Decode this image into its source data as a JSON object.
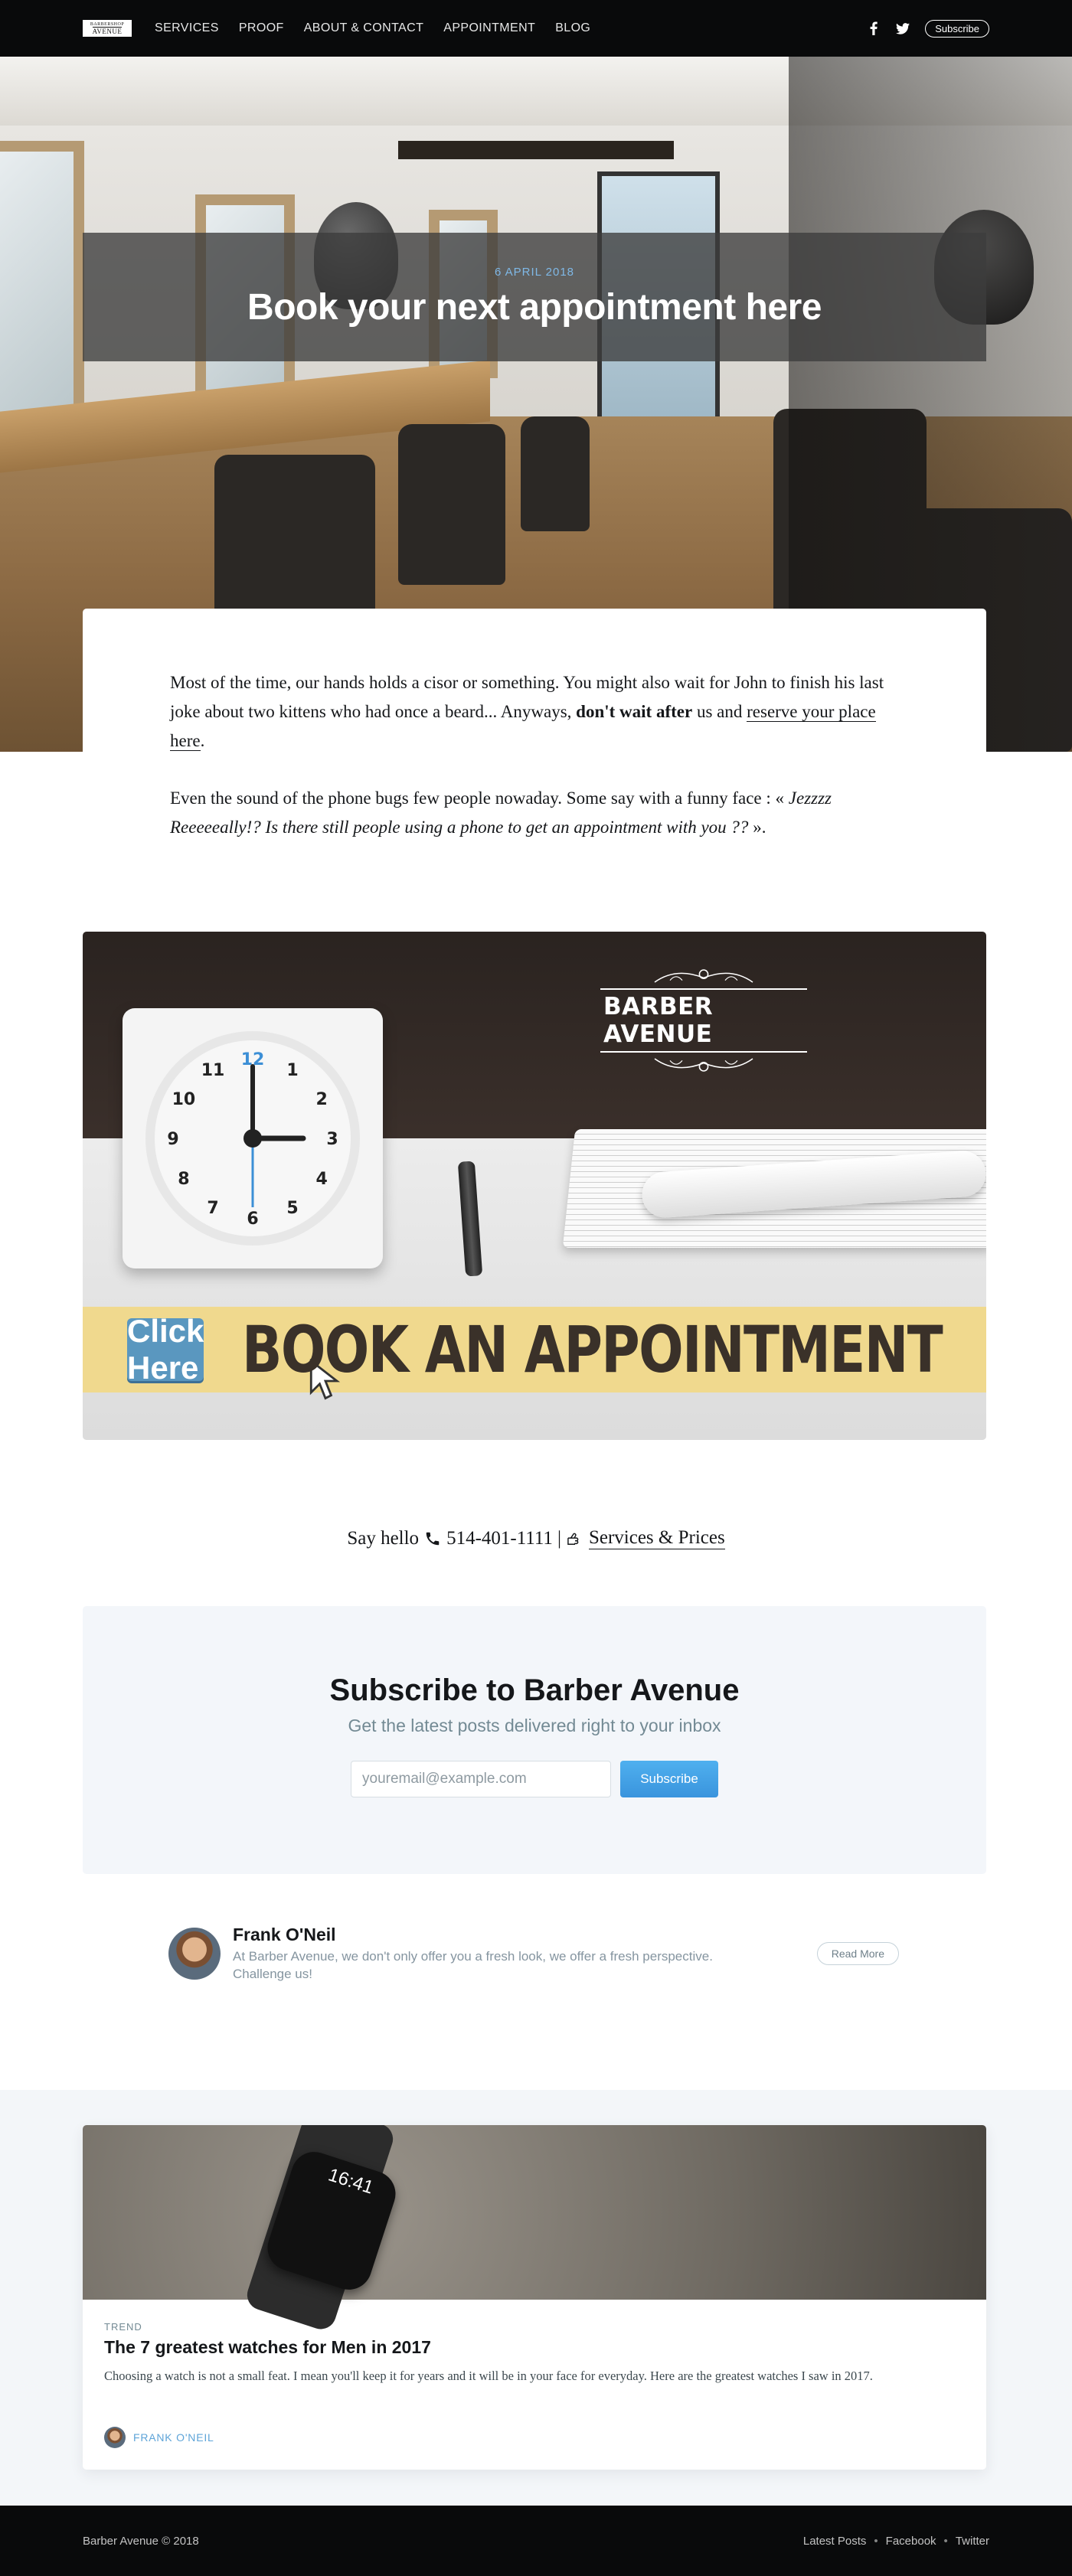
{
  "nav": {
    "logo_line1": "BARBERSHOP",
    "logo_line2": "AVENUE",
    "links": [
      "SERVICES",
      "PROOF",
      "ABOUT & CONTACT",
      "APPOINTMENT",
      "BLOG"
    ],
    "social_icons": [
      "facebook-icon",
      "twitter-icon"
    ],
    "subscribe_label": "Subscribe"
  },
  "hero": {
    "date": "6 APRIL 2018",
    "title": "Book your next appointment here"
  },
  "post": {
    "p1_start": "Most of the time, our hands holds a cisor or something. You might also wait for John to finish his last joke about two kittens who had once a beard... Anyways, ",
    "p1_bold": "don't wait after",
    "p1_mid": " us and ",
    "p1_link": "reserve your place here",
    "p1_end": ".",
    "p2_start": "Even the sound of the phone bugs few people nowaday. Some say with a funny face : « ",
    "p2_italic": "Jezzzz Reeeeeally!? Is there still people using a phone to get an appointment with you ??",
    "p2_end": " »."
  },
  "banner": {
    "brand_name": "BARBER AVENUE",
    "click_label": "Click Here",
    "book_text": "BOOK AN APPOINTMENT",
    "clock_numbers": [
      "12",
      "1",
      "2",
      "3",
      "4",
      "5",
      "6",
      "7",
      "8",
      "9",
      "10",
      "11"
    ]
  },
  "say_hello": {
    "lead": "Say hello",
    "phone": "514-401-1111",
    "separator": "|",
    "services_link": "Services & Prices"
  },
  "subscribe": {
    "title": "Subscribe to Barber Avenue",
    "description": "Get the latest posts delivered right to your inbox",
    "placeholder": "youremail@example.com",
    "button": "Subscribe"
  },
  "author": {
    "name": "Frank O'Neil",
    "bio": "At Barber Avenue, we don't only offer you a fresh look, we offer a fresh perspective. Challenge us!",
    "read_more": "Read More"
  },
  "read_next": {
    "watch_time": "16:41",
    "tag": "TREND",
    "title": "The 7 greatest watches for Men in 2017",
    "excerpt": "Choosing a watch is not a small feat. I mean you'll keep it for years and it will be in your face for everyday. Here are the greatest watches I saw in 2017.",
    "author": "FRANK O'NEIL"
  },
  "footer": {
    "copyright": "Barber Avenue © 2018",
    "links": [
      "Latest Posts",
      "Facebook",
      "Twitter"
    ],
    "separator": "•"
  },
  "colors": {
    "nav_bg": "#090a0b",
    "accent_blue": "#3eb0ef",
    "date_blue": "#7fb8e6",
    "banner_strip": "#f0d98e",
    "click_button": "#5a97bf",
    "subscribe_bg": "#f3f6fa"
  }
}
